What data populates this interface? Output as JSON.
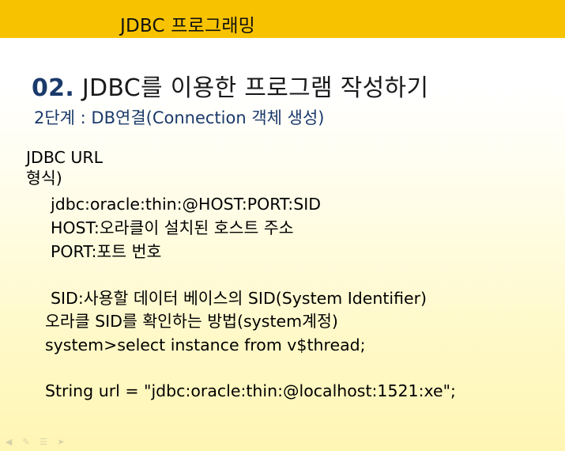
{
  "header": {
    "title": "JDBC 프로그래밍"
  },
  "slide": {
    "title_number": "02.",
    "title_text": " JDBC를 이용한 프로그램 작성하기",
    "subtitle": "2단계 : DB연결(Connection 객체 생성)"
  },
  "content": {
    "lines": [
      "JDBC URL",
      "형식)",
      "jdbc:oracle:thin:@HOST:PORT:SID",
      "HOST:오라클이 설치된 호스트 주소",
      "PORT:포트 번호",
      "SID:사용할 데이터 베이스의 SID(System Identifier)",
      "오라클 SID를 확인하는 방법(system계정)",
      "system>select instance from v$thread;",
      "String url = \"jdbc:oracle:thin:@localhost:1521:xe\";"
    ]
  },
  "nav": {
    "icons": [
      "arrow-left-icon",
      "pen-icon",
      "menu-icon",
      "arrow-right-icon"
    ]
  }
}
